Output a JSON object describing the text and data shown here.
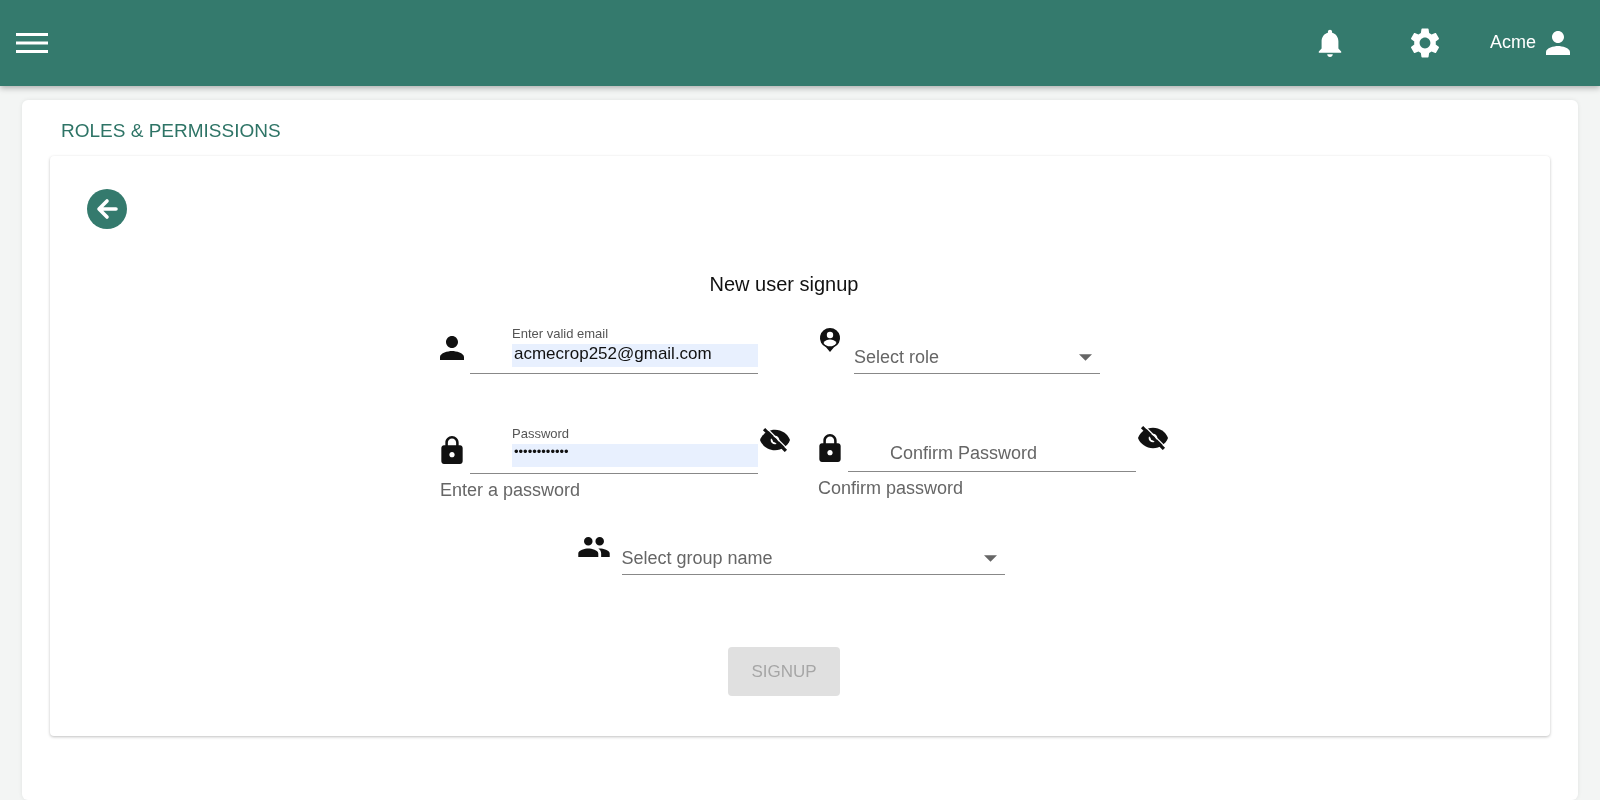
{
  "top_bar": {
    "user_name": "Acme"
  },
  "page_title": "ROLES & PERMISSIONS",
  "form": {
    "title": "New user signup",
    "email_field": {
      "label": "Enter valid email",
      "value": "acmecrop252@gmail.com",
      "autofilled": true
    },
    "role_select": {
      "placeholder": "Select role"
    },
    "password_field": {
      "label": "Password",
      "value": "••••••••••••",
      "autofilled": true,
      "visible": false,
      "helper": "Enter a password"
    },
    "confirm_password_field": {
      "placeholder": "Confirm Password",
      "visible": false,
      "helper": "Confirm password"
    },
    "group_select": {
      "placeholder": "Select group name"
    },
    "submit_button": {
      "label": "SIGNUP",
      "disabled": true
    }
  }
}
